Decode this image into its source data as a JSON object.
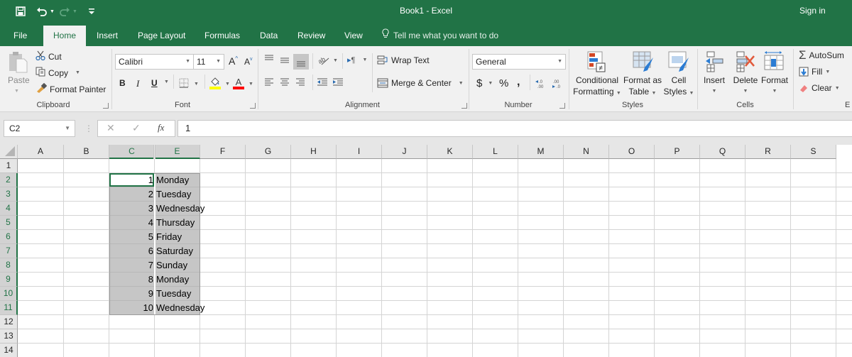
{
  "titlebar": {
    "title": "Book1  -  Excel",
    "sign_in": "Sign in",
    "qat": [
      "save-icon",
      "undo-icon",
      "redo-icon",
      "customize-qat-icon"
    ]
  },
  "tabs": [
    {
      "label": "File",
      "active": false
    },
    {
      "label": "Home",
      "active": true
    },
    {
      "label": "Insert",
      "active": false
    },
    {
      "label": "Page Layout",
      "active": false
    },
    {
      "label": "Formulas",
      "active": false
    },
    {
      "label": "Data",
      "active": false
    },
    {
      "label": "Review",
      "active": false
    },
    {
      "label": "View",
      "active": false
    }
  ],
  "tell_me": "Tell me what you want to do",
  "ribbon": {
    "clipboard": {
      "label": "Clipboard",
      "paste": "Paste",
      "cut": "Cut",
      "copy": "Copy",
      "format_painter": "Format Painter"
    },
    "font": {
      "label": "Font",
      "font_name": "Calibri",
      "font_size": "11",
      "bold": "B",
      "italic": "I",
      "underline": "U",
      "grow": "A",
      "shrink": "A",
      "fill_color": "#ffff00",
      "font_color": "#ff0000"
    },
    "alignment": {
      "label": "Alignment",
      "wrap_text": "Wrap Text",
      "merge_center": "Merge & Center"
    },
    "number": {
      "label": "Number",
      "format": "General",
      "currency": "$",
      "percent": "%",
      "comma": ",",
      "inc_decimal": "←.0 .00",
      "dec_decimal": ".00 →.0"
    },
    "styles": {
      "label": "Styles",
      "conditional_formatting": [
        "Conditional",
        "Formatting"
      ],
      "format_as_table": [
        "Format as",
        "Table"
      ],
      "cell_styles": [
        "Cell",
        "Styles"
      ]
    },
    "cells": {
      "label": "Cells",
      "insert": "Insert",
      "delete": "Delete",
      "format": "Format"
    },
    "editing": {
      "label": "E",
      "autosum": "AutoSum",
      "fill": "Fill",
      "clear": "Clear"
    }
  },
  "formula_bar": {
    "name_box": "C2",
    "fx": "fx",
    "value": "1"
  },
  "sheet": {
    "columns": [
      "A",
      "B",
      "C",
      "E",
      "F",
      "G",
      "H",
      "I",
      "J",
      "K",
      "L",
      "M",
      "N",
      "O",
      "P",
      "Q",
      "R",
      "S"
    ],
    "selected_columns": [
      "C",
      "E"
    ],
    "rows": [
      "1",
      "2",
      "3",
      "4",
      "5",
      "6",
      "7",
      "8",
      "9",
      "10",
      "11",
      "12",
      "13",
      "14"
    ],
    "selected_rows": [
      "2",
      "3",
      "4",
      "5",
      "6",
      "7",
      "8",
      "9",
      "10",
      "11"
    ],
    "active_cell": "C2",
    "selection": "C2:E11",
    "data": [
      {
        "row": "2",
        "C": "1",
        "E": "Monday"
      },
      {
        "row": "3",
        "C": "2",
        "E": "Tuesday"
      },
      {
        "row": "4",
        "C": "3",
        "E": "Wednesday"
      },
      {
        "row": "5",
        "C": "4",
        "E": "Thursday"
      },
      {
        "row": "6",
        "C": "5",
        "E": "Friday"
      },
      {
        "row": "7",
        "C": "6",
        "E": "Saturday"
      },
      {
        "row": "8",
        "C": "7",
        "E": "Sunday"
      },
      {
        "row": "9",
        "C": "8",
        "E": "Monday"
      },
      {
        "row": "10",
        "C": "9",
        "E": "Tuesday"
      },
      {
        "row": "11",
        "C": "10",
        "E": "Wednesday"
      }
    ]
  },
  "colors": {
    "accent": "#217346",
    "selection_fill": "#c6c6c6"
  }
}
